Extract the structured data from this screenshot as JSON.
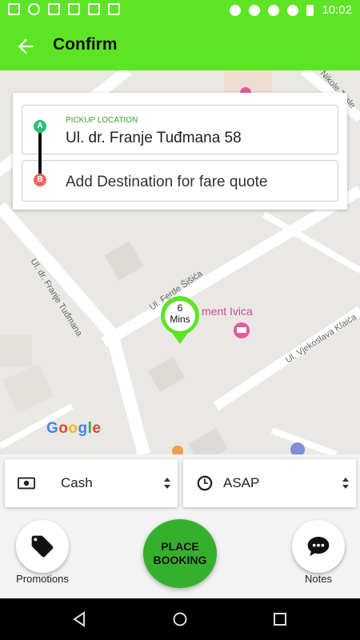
{
  "status_bar": {
    "time": "10:02"
  },
  "app_bar": {
    "title": "Confirm"
  },
  "address": {
    "pickup_caption": "PICKUP LOCATION",
    "pickup_value": "Ul. dr. Franje Tuđmana 58",
    "destination_placeholder": "Add Destination for fare quote",
    "marker_a": "A",
    "marker_b": "B"
  },
  "map": {
    "street_labels": [
      "Nikole Tesle",
      "Ul. dr. Franje Tuđmana",
      "Ul. Ferde Šišića",
      "Ul. Vjekoslava Klaića"
    ],
    "poi_label": "ment Ivica",
    "google_logo": [
      "G",
      "o",
      "o",
      "g",
      "l",
      "e"
    ],
    "google_colors": [
      "#4285F4",
      "#EA4335",
      "#FBBC05",
      "#4285F4",
      "#34A853",
      "#EA4335"
    ],
    "eta_value": "6",
    "eta_unit": "Mins"
  },
  "booking": {
    "payment_label": "Cash",
    "time_label": "ASAP",
    "place_booking_line1": "PLACE",
    "place_booking_line2": "BOOKING",
    "promotions_label": "Promotions",
    "notes_label": "Notes"
  },
  "colors": {
    "accent": "#5ce524",
    "booking_button": "#35b02c",
    "pickup_marker": "#2ec07a",
    "destination_marker": "#f0655a"
  }
}
